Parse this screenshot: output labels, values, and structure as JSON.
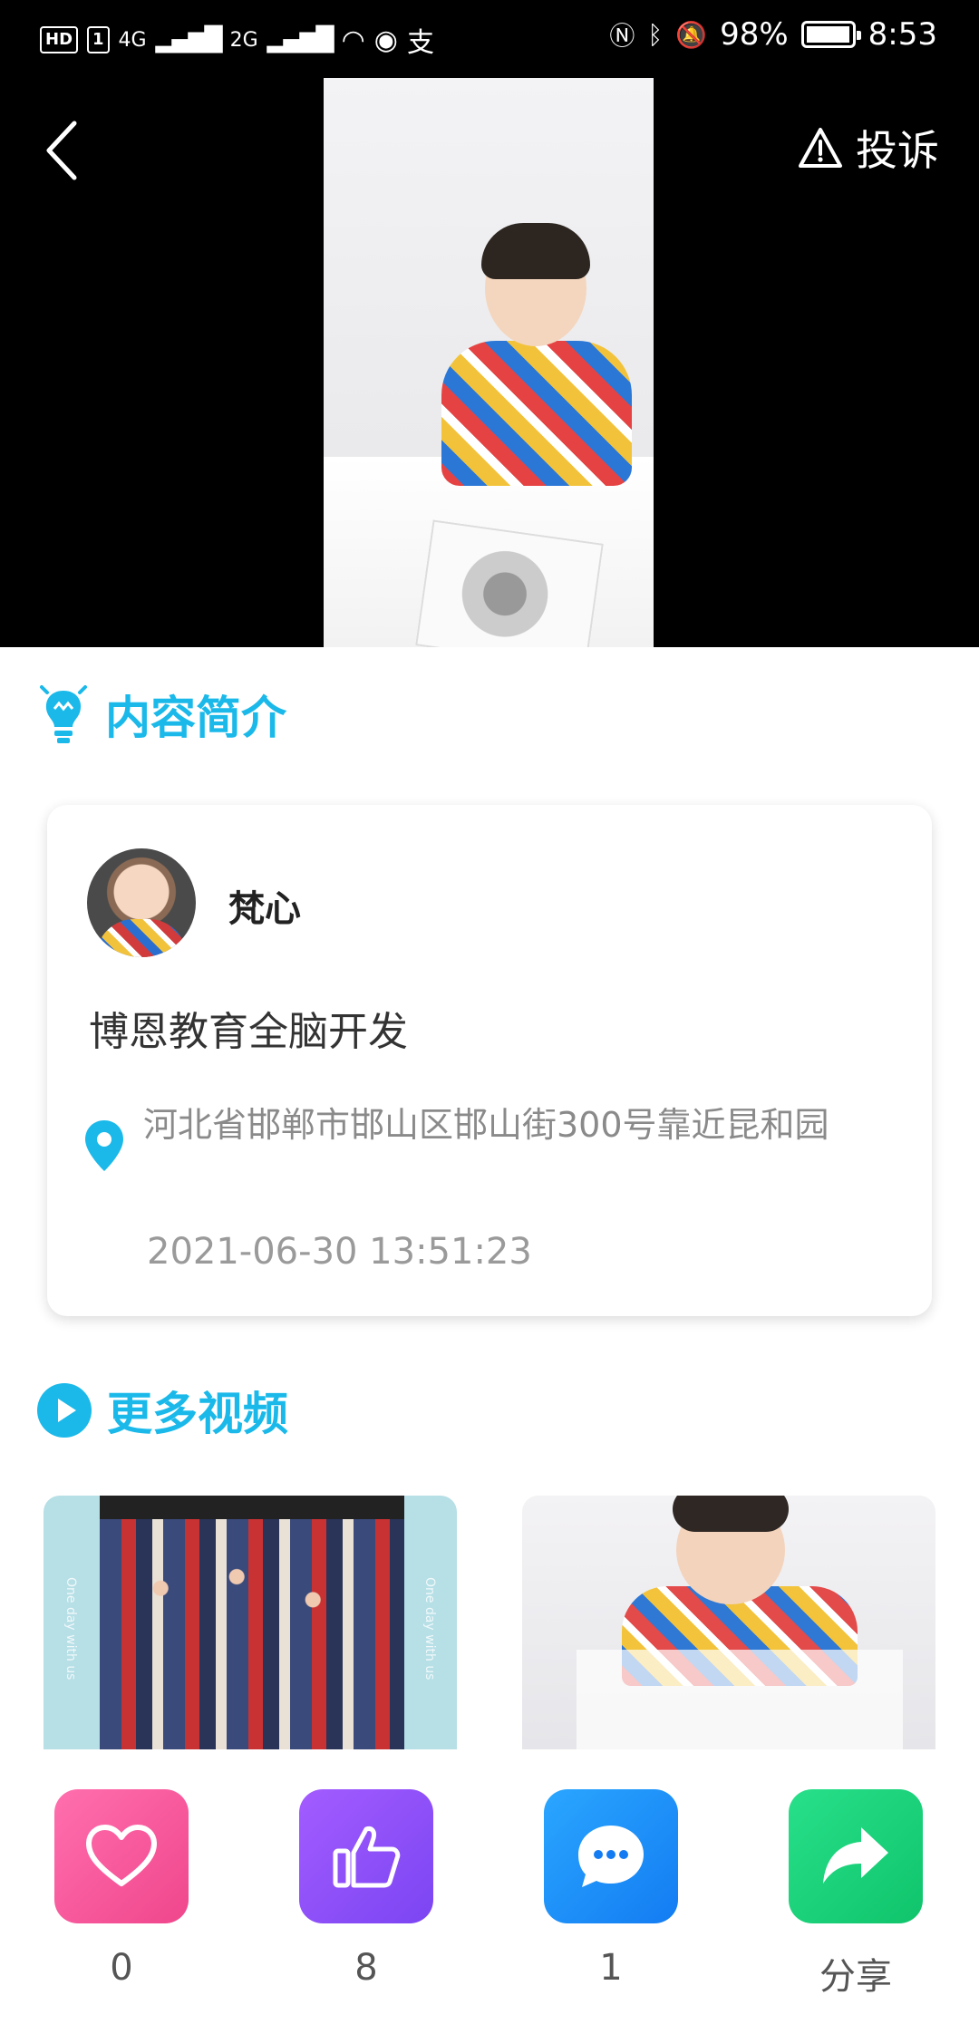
{
  "status_bar": {
    "hd_label": "HD",
    "sim1": "1",
    "net1": "4G",
    "net2": "2G",
    "battery": "98%",
    "battery_level": 0.98,
    "time": "8:53"
  },
  "video": {
    "report_label": "投诉"
  },
  "intro": {
    "heading": "内容简介",
    "author": "梵心",
    "description": "博恩教育全脑开发",
    "address": "河北省邯郸市邯山区邯山街300号靠近昆和园",
    "timestamp": "2021-06-30 13:51:23"
  },
  "more_videos": {
    "heading": "更多视频",
    "thumb1_side_text": "One day with us"
  },
  "actions": {
    "favorite_count": "0",
    "like_count": "8",
    "comment_count": "1",
    "share_label": "分享"
  },
  "colors": {
    "accent": "#1ab9ea",
    "favorite": "#f0468c",
    "like": "#7b45f2",
    "comment": "#137cf2",
    "share": "#0fc46b"
  }
}
